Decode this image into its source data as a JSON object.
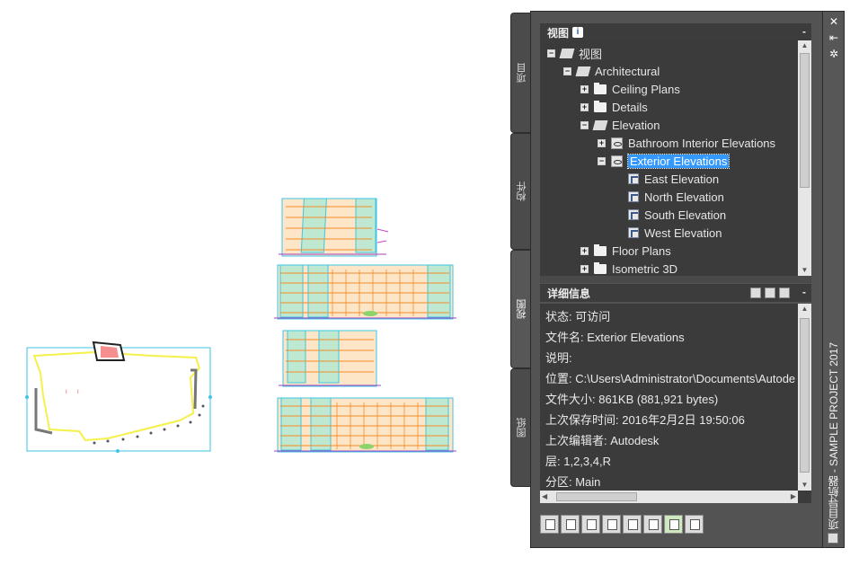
{
  "tabs": [
    {
      "label": "项目"
    },
    {
      "label": "构件"
    },
    {
      "label": "视图"
    },
    {
      "label": "图纸"
    }
  ],
  "views_panel": {
    "title": "视图",
    "info_icon": "i",
    "minimize_label": "-"
  },
  "tree": {
    "root": "视图",
    "architectural": "Architectural",
    "ceiling_plans": "Ceiling Plans",
    "details": "Details",
    "elevation": "Elevation",
    "bathroom": "Bathroom Interior Elevations",
    "exterior": "Exterior Elevations",
    "east": "East Elevation",
    "north": "North Elevation",
    "south": "South Elevation",
    "west": "West Elevation",
    "floor_plans": "Floor Plans",
    "isometric": "Isometric 3D"
  },
  "details_panel": {
    "title": "详细信息",
    "minimize_label": "-",
    "rows": [
      "状态: 可访问",
      "文件名: Exterior Elevations",
      "说明:",
      "位置: C:\\Users\\Administrator\\Documents\\Autode",
      "文件大小: 861KB (881,921 bytes)",
      "上次保存时间: 2016年2月2日  19:50:06",
      "上次编辑者: Autodesk",
      "层: 1,2,3,4,R",
      "分区: Main"
    ]
  },
  "side_strip": {
    "close": "✕",
    "pin": "⇤",
    "settings": "✲",
    "title": "项目导航器 - SAMPLE PROJECT 2017"
  },
  "colors": {
    "panel_bg": "#535353",
    "content_bg": "#3b3b3b",
    "selection": "#3399ff",
    "drawing_orange": "#f28c28",
    "drawing_cyan": "#3cc6e6",
    "drawing_yellow": "#f5f04a"
  },
  "toolbar_icons": [
    "new-view-icon",
    "new-layout-icon",
    "save-view-icon",
    "clipboard-icon",
    "select-icon",
    "table-icon",
    "refresh-icon",
    "settings-icon"
  ]
}
